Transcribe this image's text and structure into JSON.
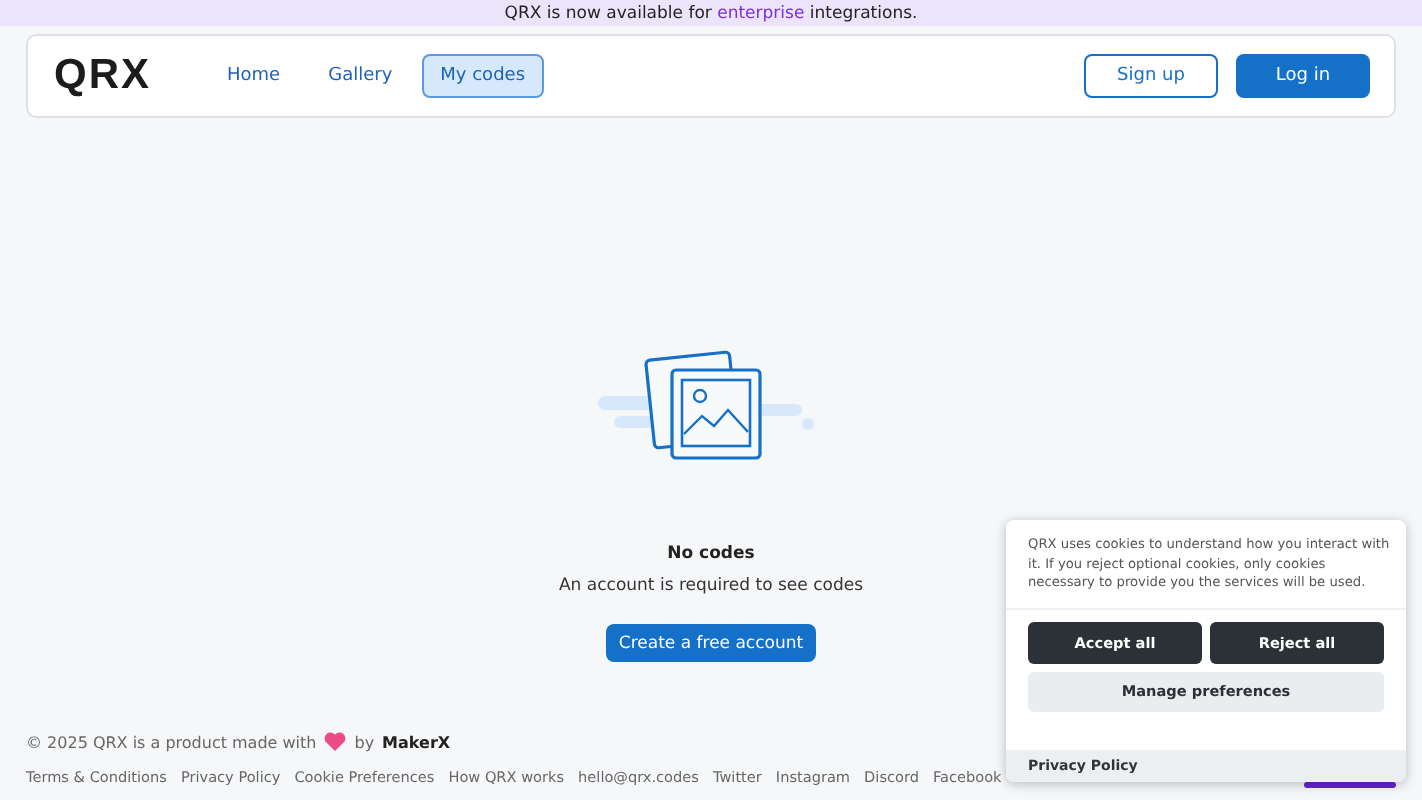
{
  "banner": {
    "before": "QRX is now available for ",
    "link": "enterprise",
    "after": " integrations."
  },
  "nav": {
    "logo": "QRX",
    "links": [
      {
        "label": "Home",
        "selected": false
      },
      {
        "label": "Gallery",
        "selected": false
      },
      {
        "label": "My codes",
        "selected": true
      }
    ],
    "signup": "Sign up",
    "login": "Log in"
  },
  "empty_state": {
    "title": "No codes",
    "message": "An account is required to see codes",
    "button": "Create a free account"
  },
  "footer": {
    "copyright_before": "© 2025 QRX is a product made with",
    "by": "by",
    "maker": "MakerX",
    "links": [
      "Terms & Conditions",
      "Privacy Policy",
      "Cookie Preferences",
      "How QRX works",
      "hello@qrx.codes",
      "Twitter",
      "Instagram",
      "Discord",
      "Facebook"
    ]
  },
  "cookie_banner": {
    "text": "QRX uses cookies to understand how you interact with it. If you reject optional cookies, only cookies necessary to provide you the services will be used.",
    "accept": "Accept all",
    "reject": "Reject all",
    "manage": "Manage preferences",
    "privacy": "Privacy Policy"
  }
}
